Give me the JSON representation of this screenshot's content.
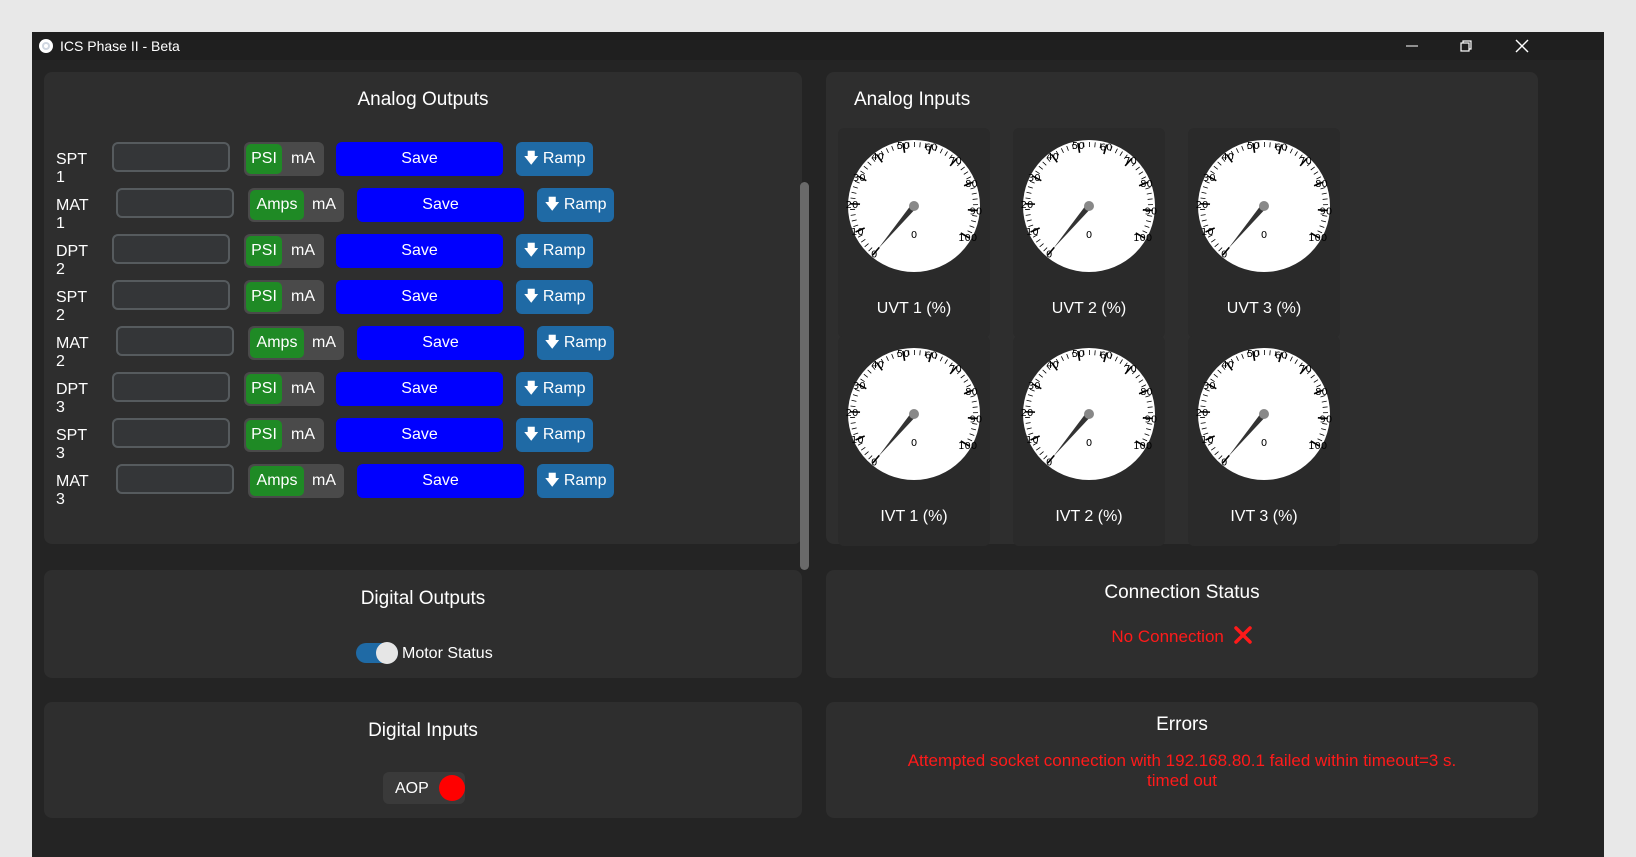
{
  "window": {
    "title": "ICS Phase II - Beta",
    "icons": [
      "app-icon",
      "minimize-icon",
      "restore-icon",
      "close-icon"
    ]
  },
  "analog_outputs": {
    "title": "Analog Outputs",
    "rows": [
      {
        "label": "SPT 1",
        "unit_on": "PSI",
        "unit_off": "mA",
        "input_value": "",
        "save": "Save",
        "ramp": "Ramp"
      },
      {
        "label": "MAT 1",
        "unit_on": "Amps",
        "unit_off": "mA",
        "input_value": "",
        "save": "Save",
        "ramp": "Ramp"
      },
      {
        "label": "DPT 2",
        "unit_on": "PSI",
        "unit_off": "mA",
        "input_value": "",
        "save": "Save",
        "ramp": "Ramp"
      },
      {
        "label": "SPT 2",
        "unit_on": "PSI",
        "unit_off": "mA",
        "input_value": "",
        "save": "Save",
        "ramp": "Ramp"
      },
      {
        "label": "MAT 2",
        "unit_on": "Amps",
        "unit_off": "mA",
        "input_value": "",
        "save": "Save",
        "ramp": "Ramp"
      },
      {
        "label": "DPT 3",
        "unit_on": "PSI",
        "unit_off": "mA",
        "input_value": "",
        "save": "Save",
        "ramp": "Ramp"
      },
      {
        "label": "SPT 3",
        "unit_on": "PSI",
        "unit_off": "mA",
        "input_value": "",
        "save": "Save",
        "ramp": "Ramp"
      },
      {
        "label": "MAT 3",
        "unit_on": "Amps",
        "unit_off": "mA",
        "input_value": "",
        "save": "Save",
        "ramp": "Ramp"
      }
    ]
  },
  "analog_inputs": {
    "title": "Analog Inputs",
    "scale": {
      "min": 0,
      "max": 100,
      "ticks": [
        "0",
        "10",
        "20",
        "30",
        "40",
        "50",
        "60",
        "70",
        "80",
        "90",
        "100"
      ]
    },
    "gauges": [
      {
        "label": "UVT 1 (%)",
        "value": 0
      },
      {
        "label": "UVT 2 (%)",
        "value": 0
      },
      {
        "label": "UVT 3 (%)",
        "value": 0
      },
      {
        "label": "IVT 1 (%)",
        "value": 0
      },
      {
        "label": "IVT 2 (%)",
        "value": 0
      },
      {
        "label": "IVT 3 (%)",
        "value": 0
      }
    ]
  },
  "digital_outputs": {
    "title": "Digital Outputs",
    "motor_status_label": "Motor Status",
    "motor_status_on": true
  },
  "connection_status": {
    "title": "Connection Status",
    "text": "No Connection",
    "icon": "x-icon",
    "color": "#ff1a1a"
  },
  "digital_inputs": {
    "title": "Digital Inputs",
    "aop_label": "AOP",
    "aop_color": "#ff0000"
  },
  "errors": {
    "title": "Errors",
    "line1": "Attempted socket connection with 192.168.80.1 failed within timeout=3 s.",
    "line2": "timed out"
  }
}
